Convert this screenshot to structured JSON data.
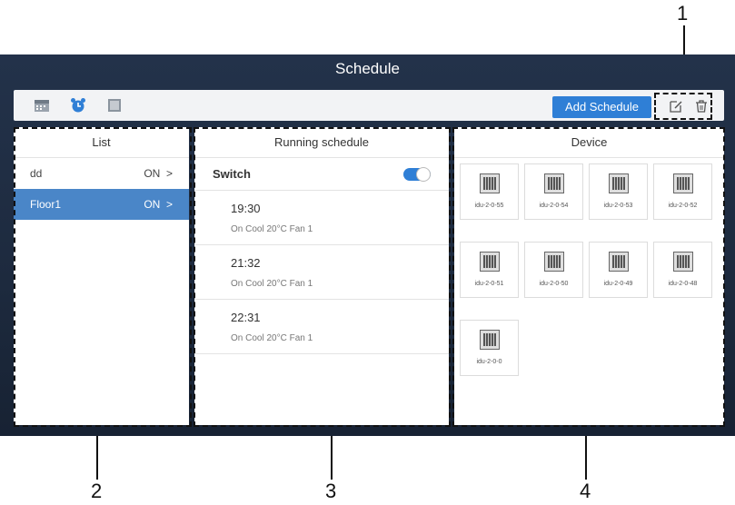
{
  "callouts": [
    "1",
    "2",
    "3",
    "4"
  ],
  "title": "Schedule",
  "toolbar": {
    "icons": [
      "calendar-icon",
      "alarm-clock-icon",
      "square-icon"
    ],
    "add_label": "Add Schedule",
    "actions": [
      "edit-icon",
      "delete-icon"
    ]
  },
  "list": {
    "header": "List",
    "items": [
      {
        "name": "dd",
        "status": "ON",
        "arrow": ">"
      },
      {
        "name": "Floor1",
        "status": "ON",
        "arrow": ">"
      }
    ]
  },
  "running": {
    "header": "Running schedule",
    "switch_label": "Switch",
    "items": [
      {
        "time": "19:30",
        "desc": "On Cool 20°C Fan 1"
      },
      {
        "time": "21:32",
        "desc": "On Cool 20°C Fan 1"
      },
      {
        "time": "22:31",
        "desc": "On Cool 20°C Fan 1"
      }
    ]
  },
  "device": {
    "header": "Device",
    "items": [
      "idu-2-0-55",
      "idu-2-0-54",
      "idu-2-0-53",
      "idu-2-0-52",
      "idu-2-0-51",
      "idu-2-0-50",
      "idu-2-0-49",
      "idu-2-0-48",
      "idu-2-0-0"
    ]
  },
  "colors": {
    "accent": "#2f7fd6",
    "selected": "#4a86c8",
    "frame": "#1d2a3e"
  }
}
